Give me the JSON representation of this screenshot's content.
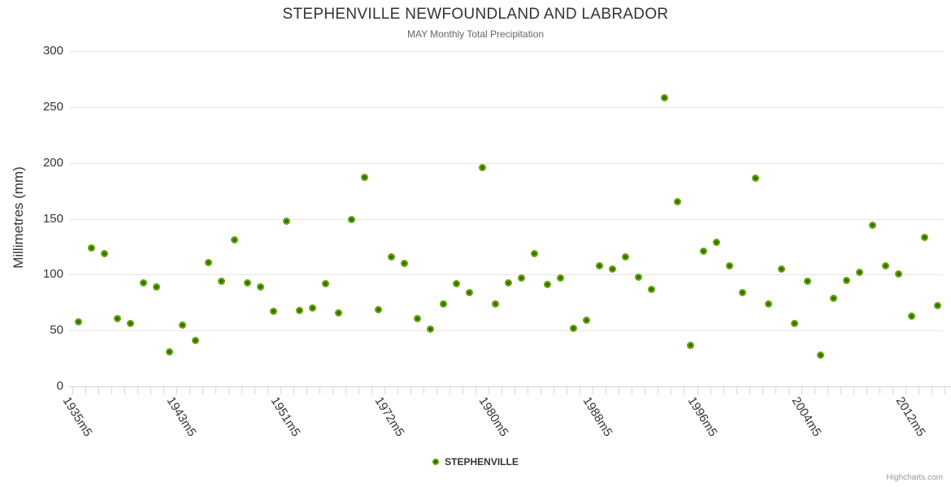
{
  "credits": "Highcharts.com",
  "colors": {
    "series_green": "#5FA30A",
    "marker_core": "#2E6B00",
    "marker_mid": "#63A307",
    "marker_outer": "#8CC63E",
    "grid": "#e6e6e6",
    "axis": "#ccd6eb",
    "title_text": "#333333",
    "subtitle_text": "#666666",
    "credits_text": "#999999"
  },
  "chart_data": {
    "type": "scatter",
    "title": "STEPHENVILLE NEWFOUNDLAND AND LABRADOR",
    "subtitle": "MAY Monthly Total Precipitation",
    "ylabel": "Millimetres (mm)",
    "ylim": [
      0,
      300
    ],
    "ytick_interval": 50,
    "yticks": [
      0,
      50,
      100,
      150,
      200,
      250,
      300
    ],
    "grid": "horizontal",
    "legend_position": "bottom-center",
    "x_tick_labels": [
      {
        "index": 0,
        "label": "1935m5"
      },
      {
        "index": 8,
        "label": "1943m5"
      },
      {
        "index": 16,
        "label": "1951m5"
      },
      {
        "index": 24,
        "label": "1972m5"
      },
      {
        "index": 32,
        "label": "1980m5"
      },
      {
        "index": 40,
        "label": "1988m5"
      },
      {
        "index": 48,
        "label": "1996m5"
      },
      {
        "index": 56,
        "label": "2004m5"
      },
      {
        "index": 64,
        "label": "2012m5"
      }
    ],
    "series": [
      {
        "name": "STEPHENVILLE",
        "color": "#5FA30A",
        "values": [
          58,
          124,
          119,
          61,
          56,
          93,
          89,
          31,
          55,
          41,
          111,
          94,
          131,
          93,
          89,
          67,
          148,
          68,
          70,
          92,
          66,
          149,
          187,
          69,
          116,
          110,
          61,
          51,
          74,
          92,
          84,
          196,
          74,
          93,
          97,
          119,
          91,
          97,
          52,
          59,
          108,
          105,
          116,
          98,
          87,
          258,
          165,
          37,
          121,
          129,
          108,
          84,
          186,
          74,
          105,
          56,
          94,
          28,
          79,
          95,
          102,
          144,
          108,
          101,
          63,
          133,
          72
        ]
      }
    ]
  }
}
